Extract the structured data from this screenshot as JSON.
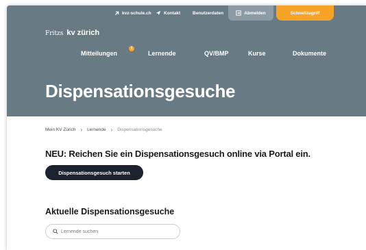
{
  "utility": {
    "site_link": "kvz-schule.ch",
    "contact": "Kontakt",
    "user_data": "Benutzerdaten",
    "logout": "Abmelden",
    "quick_access": "Schnellzugriff"
  },
  "logo": {
    "prefix": "Fritzs",
    "name": "kv zürich"
  },
  "nav": {
    "items": [
      {
        "label": "Mitteilungen",
        "badge": "1"
      },
      {
        "label": "Lernende"
      },
      {
        "label": "QV/BMP"
      },
      {
        "label": "Kurse"
      },
      {
        "label": "Dokumente"
      }
    ]
  },
  "page": {
    "title": "Dispensationsgesuche"
  },
  "breadcrumb": [
    "Mein KV Zürich",
    "Lernende",
    "Dispensationsgesuche"
  ],
  "main": {
    "headline": "NEU: Reichen Sie ein Dispensationsgesuch online via Portal ein.",
    "start_button": "Dispensationsgesuch starten",
    "section_title": "Aktuelle Dispensationsgesuche",
    "search_placeholder": "Lernende suchen",
    "search_value": ""
  },
  "colors": {
    "header_bg": "#687a84",
    "accent_orange": "#f7a325",
    "primary_dark": "#1c2230"
  }
}
